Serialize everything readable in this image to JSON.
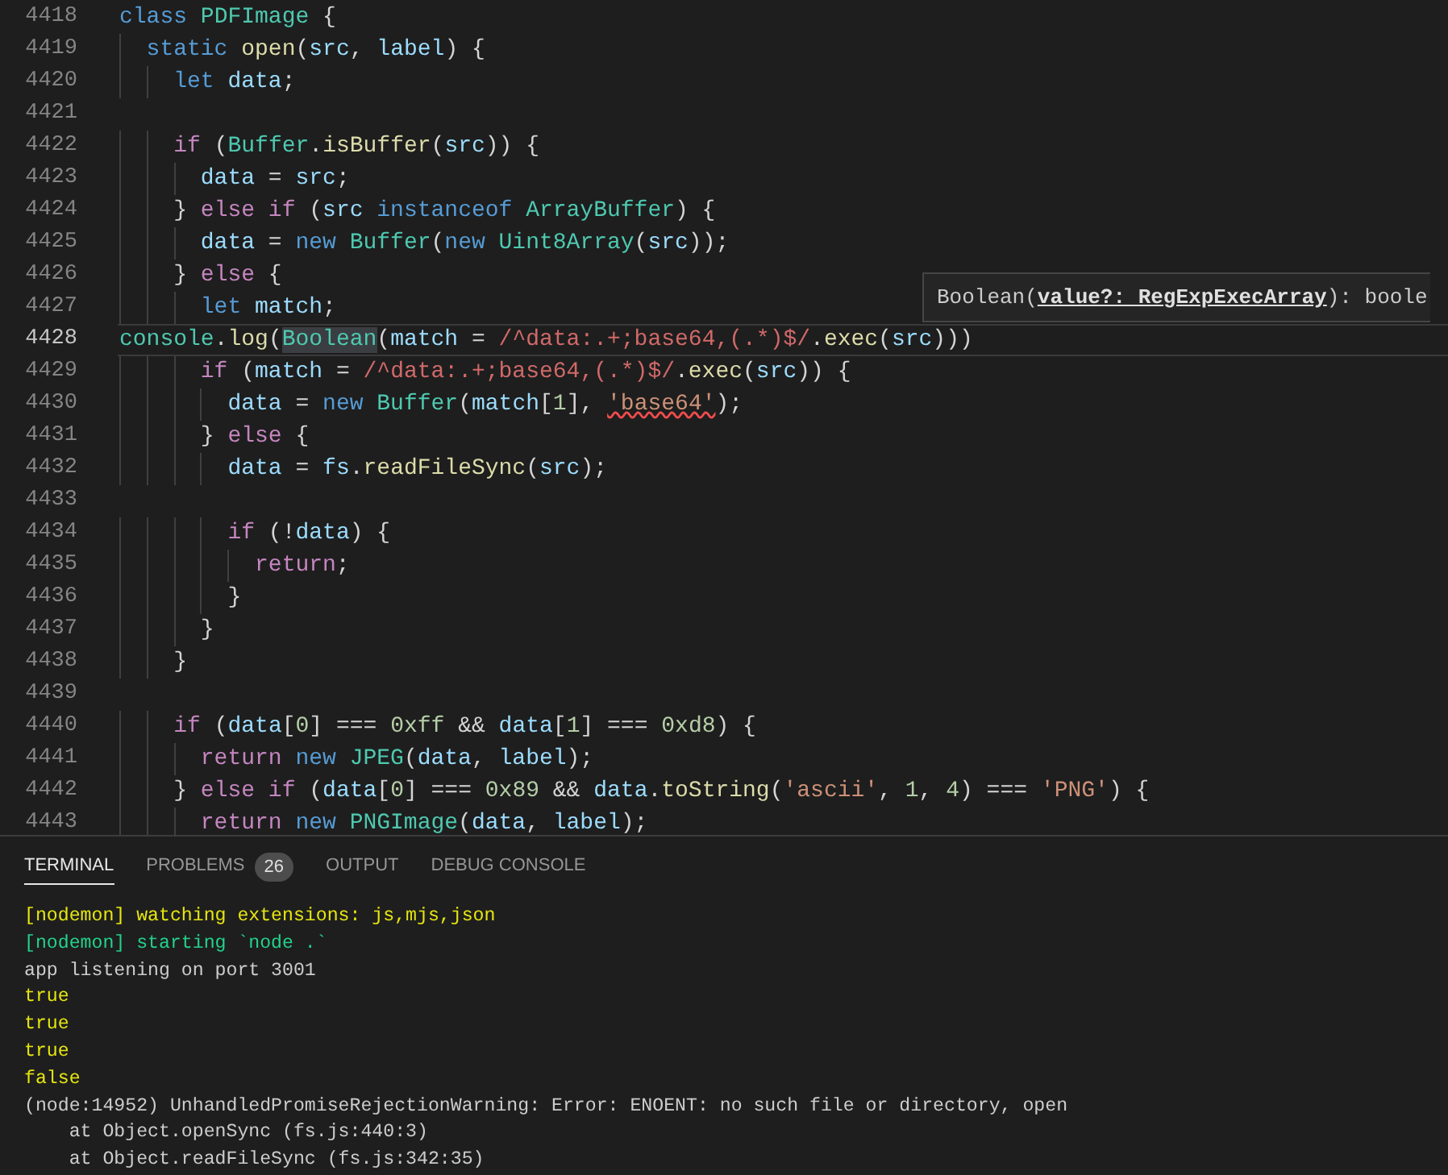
{
  "editor": {
    "lines": [
      {
        "number": "4418",
        "current": false,
        "tokens": [
          {
            "text": "class ",
            "kind": "kw"
          },
          {
            "text": "PDFImage",
            "kind": "type"
          },
          {
            "text": " {",
            "kind": "p"
          }
        ]
      },
      {
        "number": "4419",
        "current": false,
        "tokens": [
          {
            "text": "  static ",
            "kind": "kw"
          },
          {
            "text": "open",
            "kind": "fn"
          },
          {
            "text": "(",
            "kind": "p"
          },
          {
            "text": "src",
            "kind": "var"
          },
          {
            "text": ", ",
            "kind": "p"
          },
          {
            "text": "label",
            "kind": "var"
          },
          {
            "text": ") {",
            "kind": "p"
          }
        ]
      },
      {
        "number": "4420",
        "current": false,
        "tokens": [
          {
            "text": "    let ",
            "kind": "kw"
          },
          {
            "text": "data",
            "kind": "var"
          },
          {
            "text": ";",
            "kind": "p"
          }
        ]
      },
      {
        "number": "4421",
        "current": false
      },
      {
        "number": "4422",
        "current": false,
        "tokens": [
          {
            "text": "    if",
            "kind": "ctrl"
          },
          {
            "text": " (",
            "kind": "p"
          },
          {
            "text": "Buffer",
            "kind": "type"
          },
          {
            "text": ".",
            "kind": "p"
          },
          {
            "text": "isBuffer",
            "kind": "fn"
          },
          {
            "text": "(",
            "kind": "p"
          },
          {
            "text": "src",
            "kind": "var"
          },
          {
            "text": ")) {",
            "kind": "p"
          }
        ]
      },
      {
        "number": "4423",
        "current": false,
        "tokens": [
          {
            "text": "      data",
            "kind": "var"
          },
          {
            "text": " = ",
            "kind": "p"
          },
          {
            "text": "src",
            "kind": "var"
          },
          {
            "text": ";",
            "kind": "p"
          }
        ]
      },
      {
        "number": "4424",
        "current": false,
        "tokens": [
          {
            "text": "    } ",
            "kind": "p"
          },
          {
            "text": "else if",
            "kind": "ctrl"
          },
          {
            "text": " (",
            "kind": "p"
          },
          {
            "text": "src ",
            "kind": "var"
          },
          {
            "text": "instanceof ",
            "kind": "kw"
          },
          {
            "text": "ArrayBuffer",
            "kind": "type"
          },
          {
            "text": ") {",
            "kind": "p"
          }
        ]
      },
      {
        "number": "4425",
        "current": false,
        "tokens": [
          {
            "text": "      data",
            "kind": "var"
          },
          {
            "text": " = ",
            "kind": "p"
          },
          {
            "text": "new ",
            "kind": "kw"
          },
          {
            "text": "Buffer",
            "kind": "type"
          },
          {
            "text": "(",
            "kind": "p"
          },
          {
            "text": "new ",
            "kind": "kw"
          },
          {
            "text": "Uint8Array",
            "kind": "type"
          },
          {
            "text": "(",
            "kind": "p"
          },
          {
            "text": "src",
            "kind": "var"
          },
          {
            "text": "));",
            "kind": "p"
          }
        ]
      },
      {
        "number": "4426",
        "current": false,
        "tokens": [
          {
            "text": "    } ",
            "kind": "p"
          },
          {
            "text": "else",
            "kind": "ctrl"
          },
          {
            "text": " {",
            "kind": "p"
          }
        ]
      },
      {
        "number": "4427",
        "current": false,
        "tokens": [
          {
            "text": "      let ",
            "kind": "kw"
          },
          {
            "text": "match",
            "kind": "var"
          },
          {
            "text": ";",
            "kind": "p"
          }
        ]
      },
      {
        "number": "4428",
        "current": true,
        "tokens": [
          {
            "text": "console",
            "kind": "type"
          },
          {
            "text": ".",
            "kind": "p"
          },
          {
            "text": "log",
            "kind": "fn"
          },
          {
            "text": "(",
            "kind": "p"
          },
          {
            "text": "Boolean",
            "kind": "type-hl"
          },
          {
            "text": "(",
            "kind": "p"
          },
          {
            "text": "match",
            "kind": "var"
          },
          {
            "text": " = ",
            "kind": "p"
          },
          {
            "text": "/^data:.+;base64,(.*)$/",
            "kind": "regex"
          },
          {
            "text": ".",
            "kind": "p"
          },
          {
            "text": "exec",
            "kind": "fn"
          },
          {
            "text": "(",
            "kind": "p"
          },
          {
            "text": "src",
            "kind": "var"
          },
          {
            "text": ")))",
            "kind": "p"
          }
        ]
      },
      {
        "number": "4429",
        "current": false,
        "tokens": [
          {
            "text": "      if",
            "kind": "ctrl"
          },
          {
            "text": " (",
            "kind": "p"
          },
          {
            "text": "match",
            "kind": "var"
          },
          {
            "text": " = ",
            "kind": "p"
          },
          {
            "text": "/^data:.+;base64,(.*)$/",
            "kind": "regex"
          },
          {
            "text": ".",
            "kind": "p"
          },
          {
            "text": "exec",
            "kind": "fn"
          },
          {
            "text": "(",
            "kind": "p"
          },
          {
            "text": "src",
            "kind": "var"
          },
          {
            "text": ")) {",
            "kind": "p"
          }
        ]
      },
      {
        "number": "4430",
        "current": false,
        "tokens": [
          {
            "text": "        data",
            "kind": "var"
          },
          {
            "text": " = ",
            "kind": "p"
          },
          {
            "text": "new ",
            "kind": "kw"
          },
          {
            "text": "Buffer",
            "kind": "type"
          },
          {
            "text": "(",
            "kind": "p"
          },
          {
            "text": "match",
            "kind": "var"
          },
          {
            "text": "[",
            "kind": "p"
          },
          {
            "text": "1",
            "kind": "num"
          },
          {
            "text": "], ",
            "kind": "p"
          },
          {
            "text": "'base64'",
            "kind": "str-error"
          },
          {
            "text": ");",
            "kind": "p"
          }
        ]
      },
      {
        "number": "4431",
        "current": false,
        "tokens": [
          {
            "text": "      } ",
            "kind": "p"
          },
          {
            "text": "else",
            "kind": "ctrl"
          },
          {
            "text": " {",
            "kind": "p"
          }
        ]
      },
      {
        "number": "4432",
        "current": false,
        "tokens": [
          {
            "text": "        data",
            "kind": "var"
          },
          {
            "text": " = ",
            "kind": "p"
          },
          {
            "text": "fs",
            "kind": "var"
          },
          {
            "text": ".",
            "kind": "p"
          },
          {
            "text": "readFileSync",
            "kind": "fn"
          },
          {
            "text": "(",
            "kind": "p"
          },
          {
            "text": "src",
            "kind": "var"
          },
          {
            "text": ");",
            "kind": "p"
          }
        ]
      },
      {
        "number": "4433",
        "current": false
      },
      {
        "number": "4434",
        "current": false,
        "tokens": [
          {
            "text": "        if",
            "kind": "ctrl"
          },
          {
            "text": " (!",
            "kind": "p"
          },
          {
            "text": "data",
            "kind": "var"
          },
          {
            "text": ") {",
            "kind": "p"
          }
        ]
      },
      {
        "number": "4435",
        "current": false,
        "tokens": [
          {
            "text": "          return",
            "kind": "ctrl"
          },
          {
            "text": ";",
            "kind": "p"
          }
        ]
      },
      {
        "number": "4436",
        "current": false,
        "tokens": [
          {
            "text": "        }",
            "kind": "p"
          }
        ]
      },
      {
        "number": "4437",
        "current": false,
        "tokens": [
          {
            "text": "      }",
            "kind": "p"
          }
        ]
      },
      {
        "number": "4438",
        "current": false,
        "tokens": [
          {
            "text": "    }",
            "kind": "p"
          }
        ]
      },
      {
        "number": "4439",
        "current": false
      },
      {
        "number": "4440",
        "current": false,
        "tokens": [
          {
            "text": "    if",
            "kind": "ctrl"
          },
          {
            "text": " (",
            "kind": "p"
          },
          {
            "text": "data",
            "kind": "var"
          },
          {
            "text": "[",
            "kind": "p"
          },
          {
            "text": "0",
            "kind": "num"
          },
          {
            "text": "] === ",
            "kind": "p"
          },
          {
            "text": "0xff",
            "kind": "num"
          },
          {
            "text": " && ",
            "kind": "p"
          },
          {
            "text": "data",
            "kind": "var"
          },
          {
            "text": "[",
            "kind": "p"
          },
          {
            "text": "1",
            "kind": "num"
          },
          {
            "text": "] === ",
            "kind": "p"
          },
          {
            "text": "0xd8",
            "kind": "num"
          },
          {
            "text": ") {",
            "kind": "p"
          }
        ]
      },
      {
        "number": "4441",
        "current": false,
        "tokens": [
          {
            "text": "      return ",
            "kind": "ctrl"
          },
          {
            "text": "new ",
            "kind": "kw"
          },
          {
            "text": "JPEG",
            "kind": "type"
          },
          {
            "text": "(",
            "kind": "p"
          },
          {
            "text": "data",
            "kind": "var"
          },
          {
            "text": ", ",
            "kind": "p"
          },
          {
            "text": "label",
            "kind": "var"
          },
          {
            "text": ");",
            "kind": "p"
          }
        ]
      },
      {
        "number": "4442",
        "current": false,
        "tokens": [
          {
            "text": "    } ",
            "kind": "p"
          },
          {
            "text": "else if",
            "kind": "ctrl"
          },
          {
            "text": " (",
            "kind": "p"
          },
          {
            "text": "data",
            "kind": "var"
          },
          {
            "text": "[",
            "kind": "p"
          },
          {
            "text": "0",
            "kind": "num"
          },
          {
            "text": "] === ",
            "kind": "p"
          },
          {
            "text": "0x89",
            "kind": "num"
          },
          {
            "text": " && ",
            "kind": "p"
          },
          {
            "text": "data",
            "kind": "var"
          },
          {
            "text": ".",
            "kind": "p"
          },
          {
            "text": "toString",
            "kind": "fn"
          },
          {
            "text": "(",
            "kind": "p"
          },
          {
            "text": "'ascii'",
            "kind": "str"
          },
          {
            "text": ", ",
            "kind": "p"
          },
          {
            "text": "1",
            "kind": "num"
          },
          {
            "text": ", ",
            "kind": "p"
          },
          {
            "text": "4",
            "kind": "num"
          },
          {
            "text": ") === ",
            "kind": "p"
          },
          {
            "text": "'PNG'",
            "kind": "str"
          },
          {
            "text": ") {",
            "kind": "p"
          }
        ]
      },
      {
        "number": "4443",
        "current": false,
        "tokens": [
          {
            "text": "      return ",
            "kind": "ctrl"
          },
          {
            "text": "new ",
            "kind": "kw"
          },
          {
            "text": "PNGImage",
            "kind": "type"
          },
          {
            "text": "(",
            "kind": "p"
          },
          {
            "text": "data",
            "kind": "var"
          },
          {
            "text": ", ",
            "kind": "p"
          },
          {
            "text": "label",
            "kind": "var"
          },
          {
            "text": ");",
            "kind": "p"
          }
        ]
      }
    ],
    "hover_tooltip": "Boolean(**value?: RegExpExecArray**): boole"
  },
  "panel": {
    "tabs": [
      {
        "label": "TERMINAL",
        "selected": true
      },
      {
        "label": "PROBLEMS",
        "selected": false,
        "badge": "26"
      },
      {
        "label": "OUTPUT",
        "selected": false
      },
      {
        "label": "DEBUG CONSOLE",
        "selected": false
      }
    ],
    "terminal_lines": [
      {
        "text": "[nodemon] watching extensions: js,mjs,json",
        "kind": "warn"
      },
      {
        "text": "[nodemon] starting `node .`",
        "kind": "info"
      },
      {
        "text": "app listening on port 3001",
        "kind": "plain"
      },
      {
        "text": "true",
        "kind": "bool"
      },
      {
        "text": "true",
        "kind": "bool"
      },
      {
        "text": "true",
        "kind": "bool"
      },
      {
        "text": "false",
        "kind": "bool"
      },
      {
        "text": "(node:14952) UnhandledPromiseRejectionWarning: Error: ENOENT: no such file or directory, open",
        "kind": "plain"
      },
      {
        "text": "    at Object.openSync (fs.js:440:3)",
        "kind": "plain"
      },
      {
        "text": "    at Object.readFileSync (fs.js:342:35)",
        "kind": "plain"
      }
    ]
  }
}
